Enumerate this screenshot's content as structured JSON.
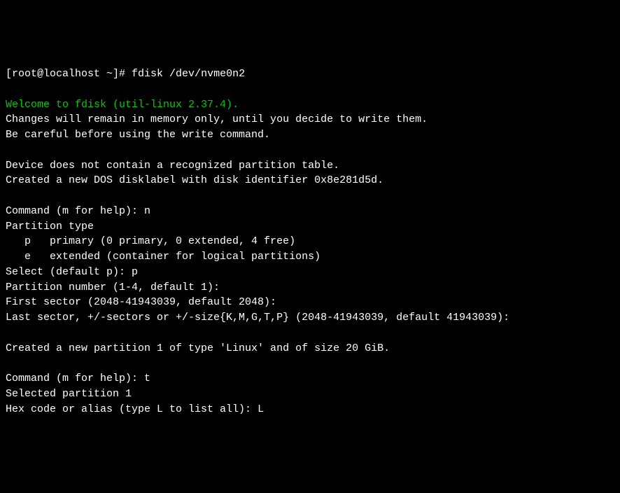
{
  "prompt": {
    "user_host": "[root@localhost ~]#",
    "command": "fdisk /dev/nvme0n2"
  },
  "welcome_line": "Welcome to fdisk (util-linux 2.37.4).",
  "info_lines": {
    "line1": "Changes will remain in memory only, until you decide to write them.",
    "line2": "Be careful before using the write command.",
    "line3": "Device does not contain a recognized partition table.",
    "line4": "Created a new DOS disklabel with disk identifier 0x8e281d5d."
  },
  "command_n": {
    "prompt": "Command (m for help): ",
    "input": "n"
  },
  "partition_type": {
    "header": "Partition type",
    "option_p": "   p   primary (0 primary, 0 extended, 4 free)",
    "option_e": "   e   extended (container for logical partitions)"
  },
  "select_p": {
    "prompt": "Select (default p): ",
    "input": "p"
  },
  "partition_number": "Partition number (1-4, default 1):",
  "first_sector": "First sector (2048-41943039, default 2048):",
  "last_sector": "Last sector, +/-sectors or +/-size{K,M,G,T,P} (2048-41943039, default 41943039):",
  "created": "Created a new partition 1 of type 'Linux' and of size 20 GiB.",
  "command_t": {
    "prompt": "Command (m for help): ",
    "input": "t"
  },
  "selected": "Selected partition 1",
  "hex_code": {
    "prompt": "Hex code or alias (type L to list all): ",
    "input": "L"
  }
}
